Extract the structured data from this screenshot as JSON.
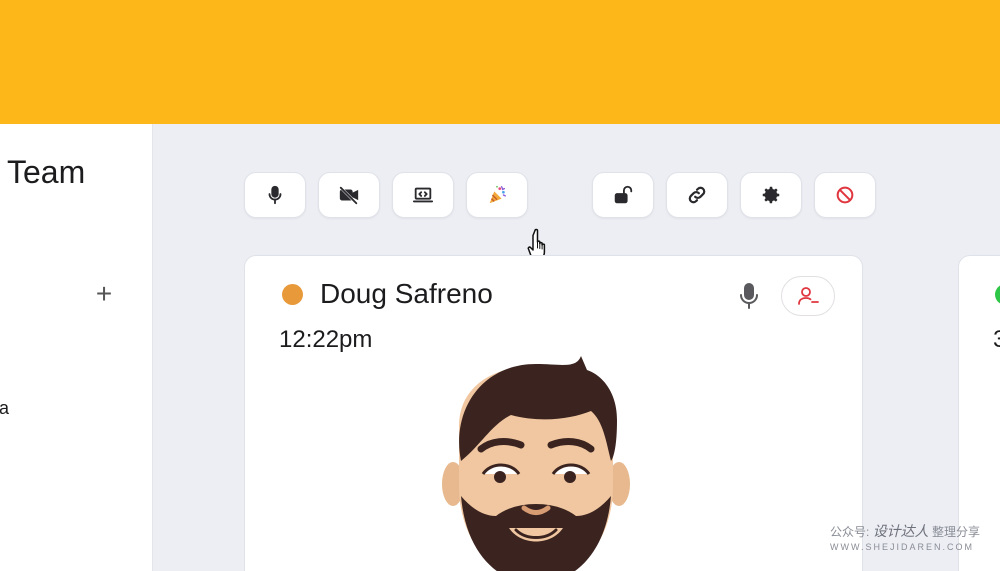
{
  "sidebar": {
    "team_title": "Team",
    "add_label": "+",
    "fragment_label": "a"
  },
  "toolbar": {
    "buttons": [
      {
        "name": "mic",
        "icon": "microphone-icon"
      },
      {
        "name": "video",
        "icon": "video-off-icon"
      },
      {
        "name": "screen-share",
        "icon": "screen-share-icon"
      },
      {
        "name": "celebrate",
        "icon": "party-popper-icon"
      },
      {
        "name": "lock",
        "icon": "unlock-icon"
      },
      {
        "name": "link",
        "icon": "link-icon"
      },
      {
        "name": "settings",
        "icon": "gear-icon"
      },
      {
        "name": "block",
        "icon": "block-icon"
      }
    ]
  },
  "participant": {
    "name": "Doug Safreno",
    "time": "12:22pm",
    "status_color": "#e8993a"
  },
  "participant2": {
    "time_fragment": "3",
    "status_color": "#2ec646"
  },
  "watermark": {
    "prefix": "公众号:",
    "name": "设计达人",
    "suffix": "整理分享",
    "url": "WWW.SHEJIDAREN.COM"
  },
  "colors": {
    "top_bar": "#fdb719",
    "accent_red": "#e0363f"
  }
}
